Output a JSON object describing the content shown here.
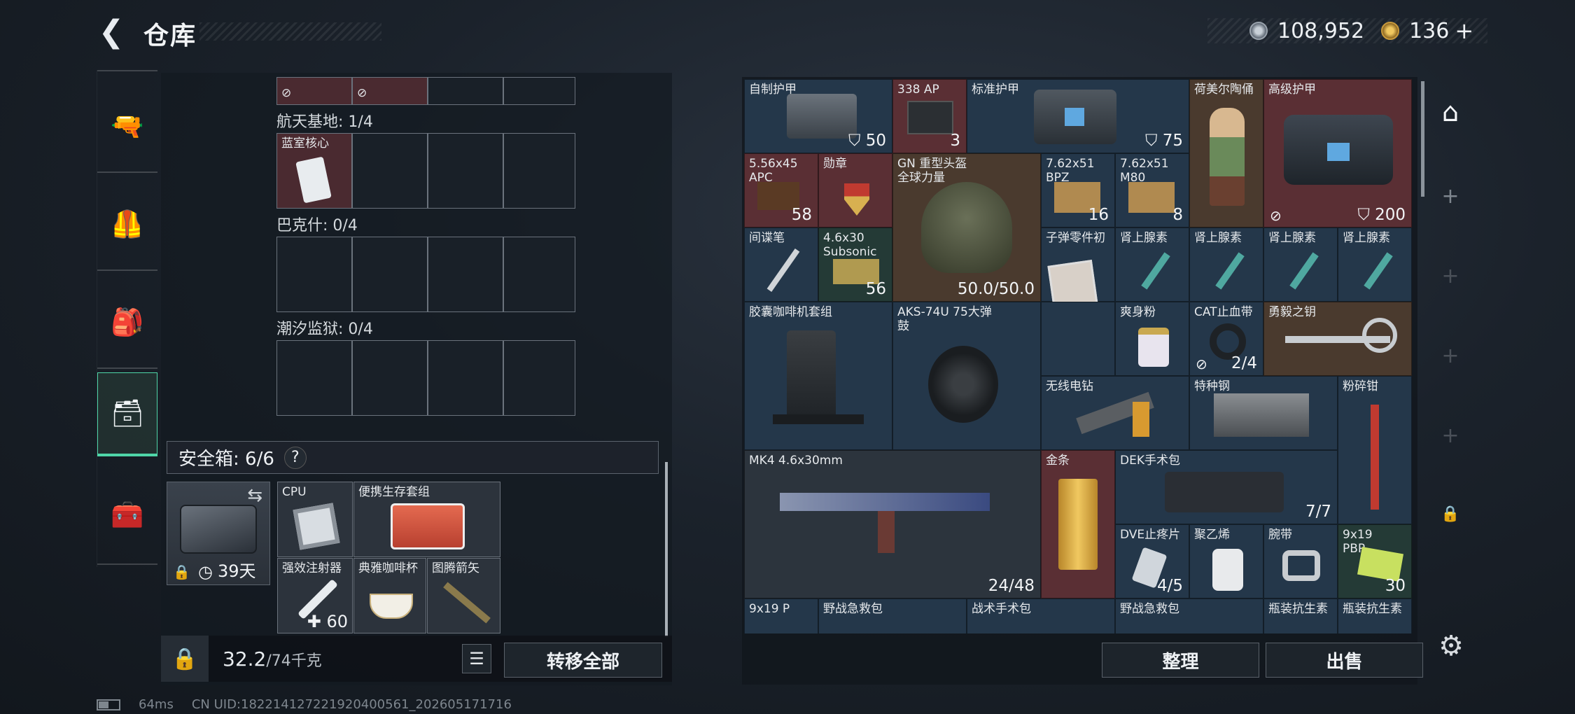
{
  "header": {
    "title": "仓库",
    "silver": "108,952",
    "gold": "136",
    "plus": "+"
  },
  "nav_left": [
    "weapon",
    "armor",
    "backpack",
    "container",
    "toolbox"
  ],
  "left_panel": {
    "sections": [
      {
        "label": "航天基地: 1/4",
        "slot_item": "蓝室核心"
      },
      {
        "label": "巴克什: 0/4"
      },
      {
        "label": "潮汐监狱: 0/4"
      }
    ],
    "safe_box": {
      "label": "安全箱: 6/6",
      "help": "?",
      "days": "39天"
    },
    "safe_items": [
      {
        "name": "CPU"
      },
      {
        "name": "便携生存套组"
      },
      {
        "name": "强效注射器",
        "count": "60"
      },
      {
        "name": "典雅咖啡杯"
      },
      {
        "name": "图腾箭矢"
      }
    ],
    "weight": "32.2",
    "weight_max": "/74千克",
    "transfer_label": "转移全部"
  },
  "grid": {
    "items": [
      {
        "name": "自制护甲",
        "value": "50"
      },
      {
        "name": "338 AP",
        "value": "3"
      },
      {
        "name": "标准护甲",
        "value": "75"
      },
      {
        "name": "荷美尔陶俑"
      },
      {
        "name": "高级护甲",
        "value": "200"
      },
      {
        "name": "5.56x45 APC",
        "value": "58"
      },
      {
        "name": "勋章"
      },
      {
        "name": "GN 重型头盔 全球力量",
        "value": "50.0/50.0"
      },
      {
        "name": "7.62x51 BPZ",
        "value": "16"
      },
      {
        "name": "7.62x51 M80",
        "value": "8"
      },
      {
        "name": "间谍笔"
      },
      {
        "name": "4.6x30 Subsonic",
        "value": "56"
      },
      {
        "name": "子弹零件初"
      },
      {
        "name": "肾上腺素"
      },
      {
        "name": "肾上腺素"
      },
      {
        "name": "肾上腺素"
      },
      {
        "name": "肾上腺素"
      },
      {
        "name": "胶囊咖啡机套组"
      },
      {
        "name": "AKS-74U 75大弹鼓"
      },
      {
        "name": "爽身粉"
      },
      {
        "name": "CAT止血带",
        "value": "2/4"
      },
      {
        "name": "勇毅之钥"
      },
      {
        "name": "无线电钻"
      },
      {
        "name": "特种钢"
      },
      {
        "name": "粉碎钳"
      },
      {
        "name": "MK4 4.6x30mm",
        "value": "24/48"
      },
      {
        "name": "金条"
      },
      {
        "name": "DEK手术包",
        "value": "7/7"
      },
      {
        "name": "DVE止疼片",
        "value": "4/5"
      },
      {
        "name": "聚乙烯"
      },
      {
        "name": "腕带"
      },
      {
        "name": "9x19 PBP",
        "value": "30"
      },
      {
        "name": "9x19 P"
      },
      {
        "name": "野战急救包"
      },
      {
        "name": "战术手术包"
      },
      {
        "name": "野战急救包"
      },
      {
        "name": "瓶装抗生素"
      },
      {
        "name": "瓶装抗生素"
      }
    ],
    "sort_label": "整理",
    "sell_label": "出售"
  },
  "status": {
    "ping": "64ms",
    "uid": "CN UID:1822141272219204005­61_202605171716"
  },
  "colors": {
    "accent": "#4fd6a8",
    "red_cell": "#5a2f34",
    "blue_cell": "#24374a"
  }
}
